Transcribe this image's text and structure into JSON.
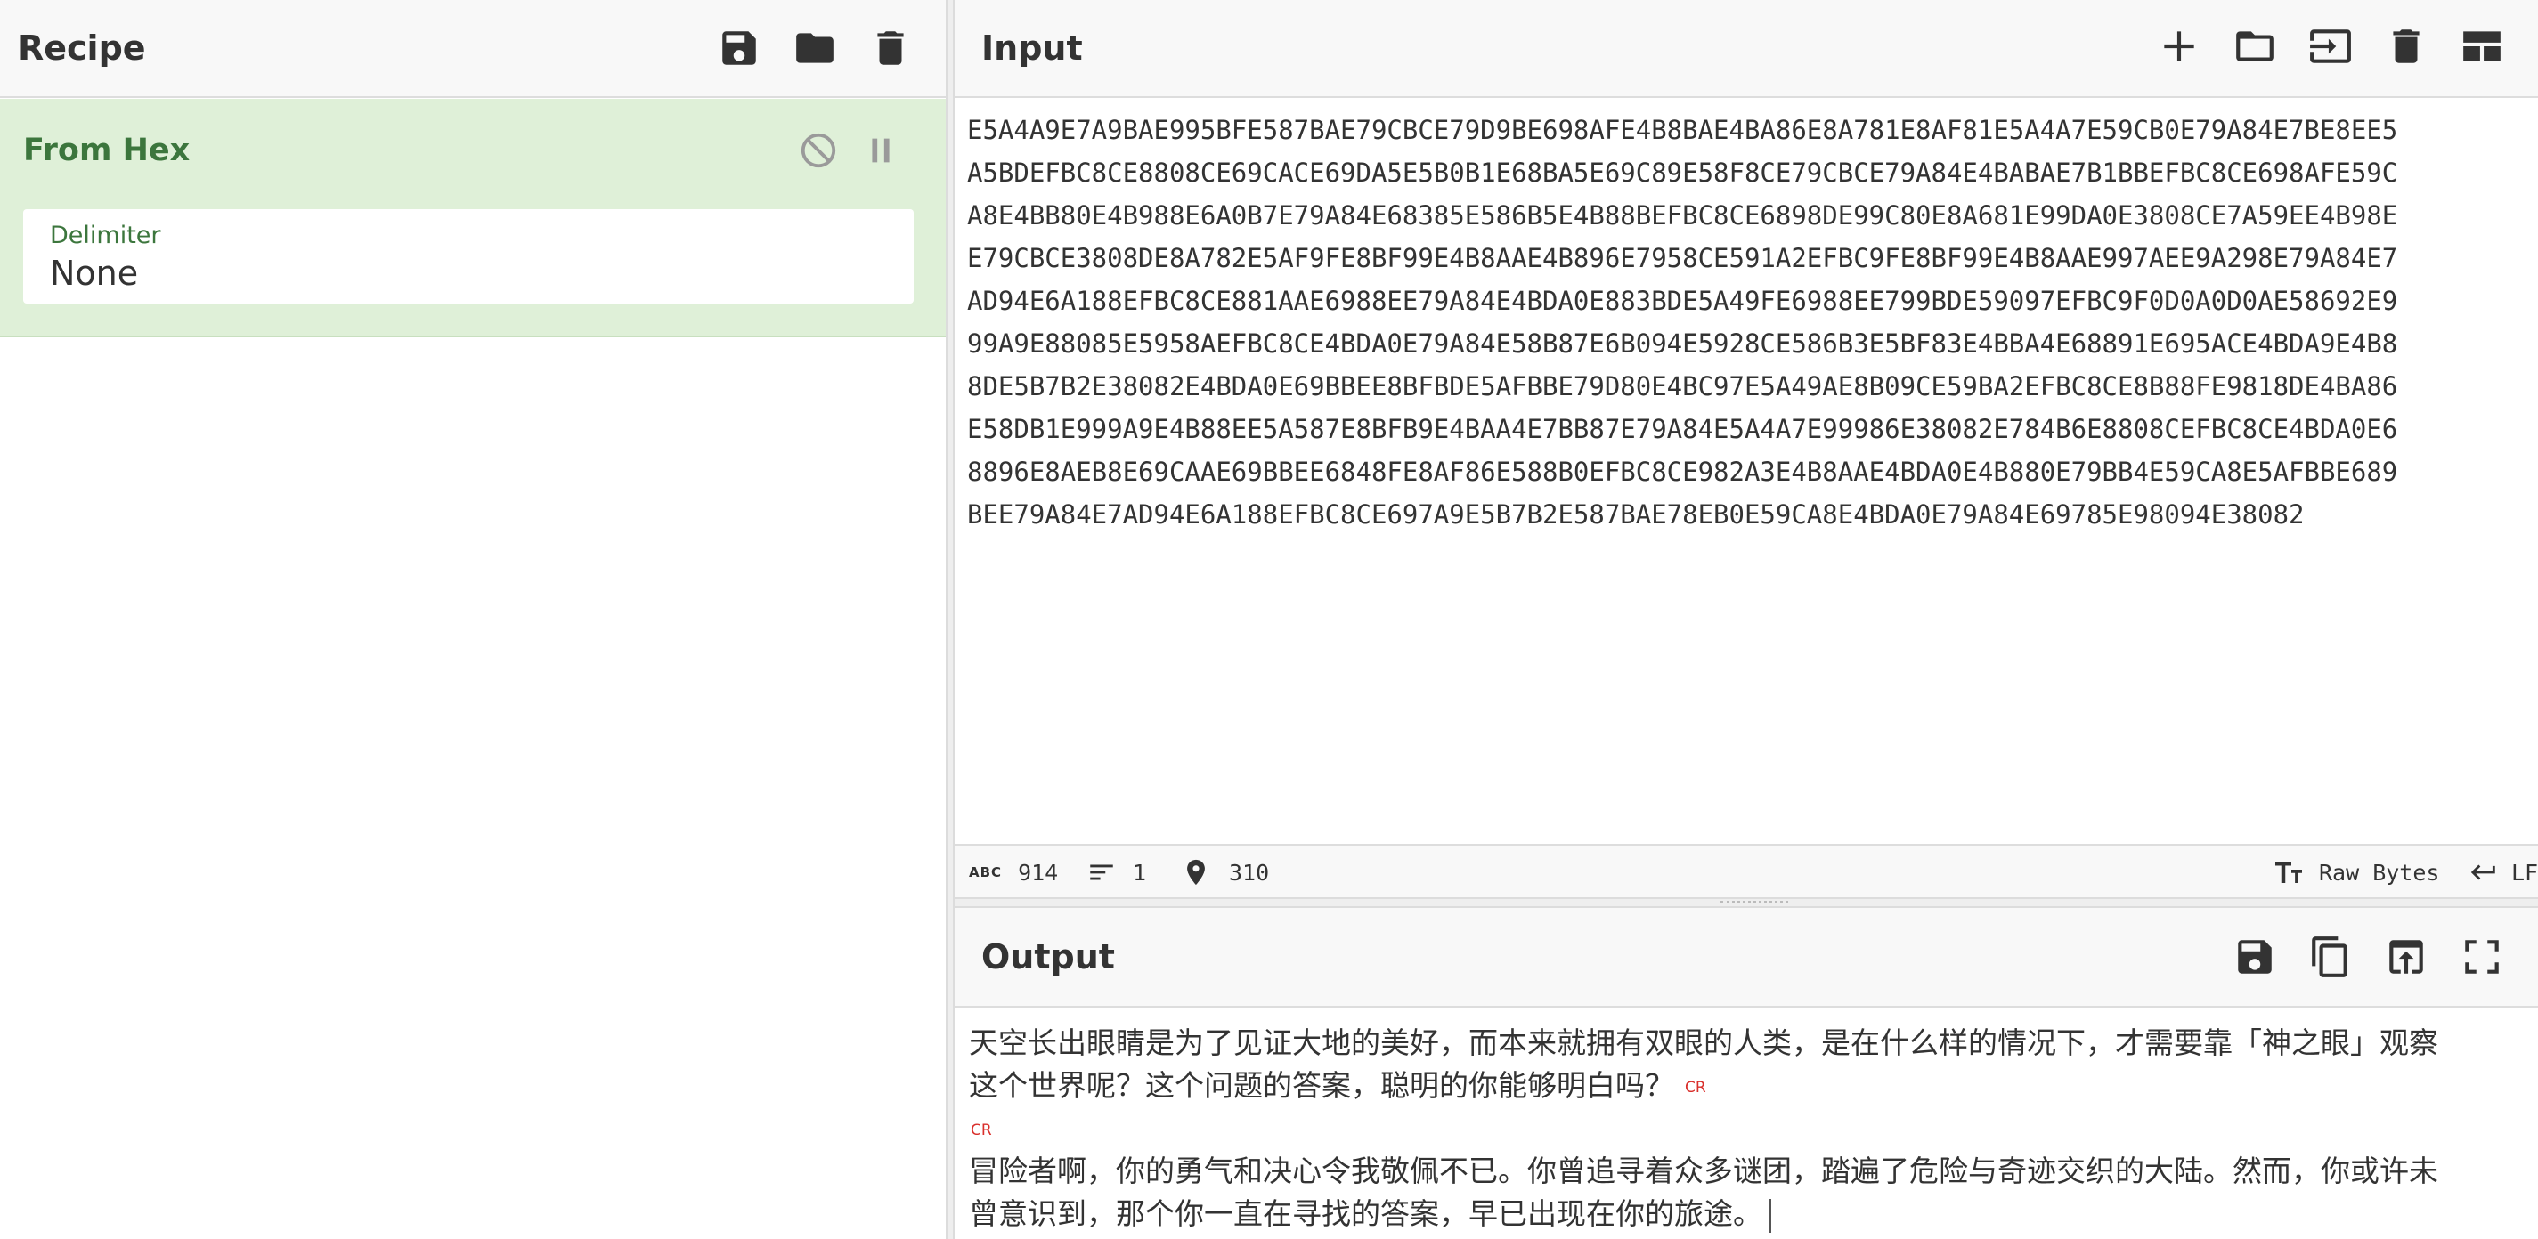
{
  "recipe": {
    "title": "Recipe",
    "header_icons": [
      "save-icon",
      "folder-icon",
      "trash-icon"
    ],
    "operation": {
      "name": "From Hex",
      "icons": [
        "disable-icon",
        "pause-icon"
      ],
      "delimiter": {
        "label": "Delimiter",
        "value": "None"
      }
    }
  },
  "input": {
    "title": "Input",
    "header_icons": [
      "add-icon",
      "folder-icon",
      "import-icon",
      "trash-icon",
      "layout-icon"
    ],
    "lines": [
      "E5A4A9E7A9BAE995BFE587BAE79CBCE79D9BE698AFE4B8BAE4BA86E8A781E8AF81E5A4A7E59CB0E79A84E7BE8EE5",
      "A5BDEFBC8CE8808CE69CACE69DA5E5B0B1E68BA5E69C89E58F8CE79CBCE79A84E4BABAE7B1BBEFBC8CE698AFE59C",
      "A8E4BB80E4B988E6A0B7E79A84E68385E586B5E4B88BEFBC8CE6898DE99C80E8A681E99DA0E3808CE7A59EE4B98E",
      "E79CBCE3808DE8A782E5AF9FE8BF99E4B8AAE4B896E7958CE591A2EFBC9FE8BF99E4B8AAE997AEE9A298E79A84E7",
      "AD94E6A188EFBC8CE881AAE6988EE79A84E4BDA0E883BDE5A49FE6988EE799BDE59097EFBC9F0D0A0D0AE58692E9",
      "99A9E88085E5958AEFBC8CE4BDA0E79A84E58B87E6B094E5928CE586B3E5BF83E4BBA4E68891E695ACE4BDA9E4B8",
      "8DE5B7B2E38082E4BDA0E69BBEE8BFBDE5AFBBE79D80E4BC97E5A49AE8B09CE59BA2EFBC8CE8B88FE9818DE4BA86",
      "E58DB1E999A9E4B88EE5A587E8BFB9E4BAA4E7BB87E79A84E5A4A7E99986E38082E784B6E8808CEFBC8CE4BDA0E6",
      "8896E8AEB8E69CAAE69BBEE6848FE8AF86E588B0EFBC8CE982A3E4B8AAE4BDA0E4B880E79BB4E59CA8E5AFBBE689",
      "BEE79A84E7AD94E6A188EFBC8CE697A9E5B7B2E587BAE78EB0E59CA8E4BDA0E79A84E69785E98094E38082"
    ]
  },
  "status": {
    "length_icon": "abc-icon",
    "length": "914",
    "lines_icon": "lines-icon",
    "lines": "1",
    "position_icon": "location-pin-icon",
    "position": "310",
    "encoding_icon": "text-size-icon",
    "encoding": "Raw Bytes",
    "eol_icon": "return-arrow-icon",
    "eol": "LF"
  },
  "output": {
    "title": "Output",
    "header_icons": [
      "save-icon",
      "copy-icon",
      "replace-input-icon",
      "fullscreen-icon"
    ],
    "lines": [
      "天空长出眼睛是为了见证大地的美好，而本来就拥有双眼的人类，是在什么样的情况下，才需要靠「神之眼」观察",
      "这个世界呢？这个问题的答案，聪明的你能够明白吗？",
      "",
      "冒险者啊，你的勇气和决心令我敬佩不已。你曾追寻着众多谜团，踏遍了危险与奇迹交织的大陆。然而，你或许未",
      "曾意识到，那个你一直在寻找的答案，早已出现在你的旅途。"
    ],
    "cr_marker": "CR"
  }
}
